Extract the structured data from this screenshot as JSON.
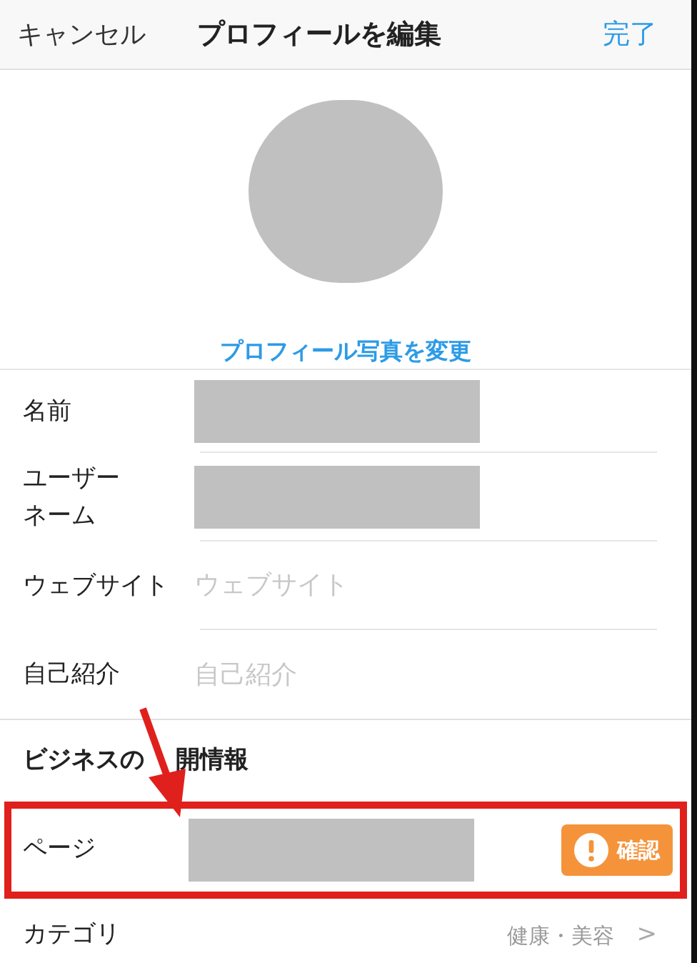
{
  "nav": {
    "cancel": "キャンセル",
    "title": "プロフィールを編集",
    "done": "完了"
  },
  "profile_photo": {
    "change_link": "プロフィール写真を変更"
  },
  "fields": [
    {
      "kind": "redacted",
      "label_lines": [
        "名前"
      ]
    },
    {
      "kind": "redacted",
      "label_lines": [
        "ユーザー",
        "ネーム"
      ]
    },
    {
      "kind": "input",
      "label_lines": [
        "ウェブサイト"
      ],
      "placeholder": "ウェブサイト"
    },
    {
      "kind": "input",
      "label_lines": [
        "自己紹介"
      ],
      "placeholder": "自己紹介"
    }
  ],
  "business_section": {
    "header_parts": [
      "ビジネスの",
      "開情報"
    ],
    "rows": [
      {
        "kind": "page",
        "label": "ページ",
        "button": "確認",
        "highlighted": true
      },
      {
        "kind": "category",
        "label": "カテゴリ",
        "value": "健康・美容",
        "chevron": ">"
      }
    ]
  }
}
